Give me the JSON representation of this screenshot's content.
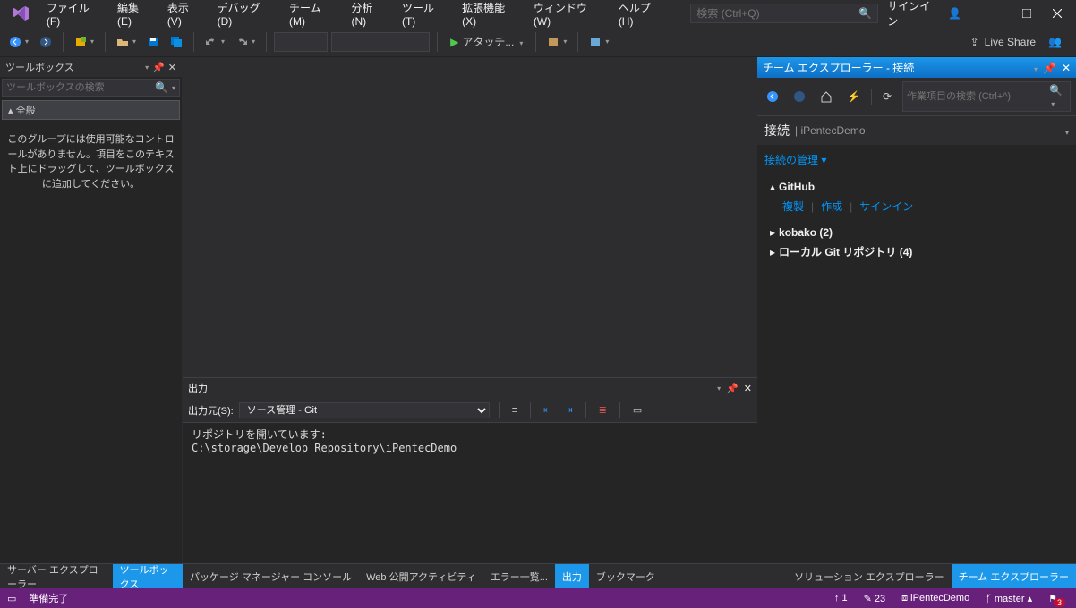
{
  "menu": [
    "ファイル(F)",
    "編集(E)",
    "表示(V)",
    "デバッグ(D)",
    "チーム(M)",
    "分析(N)",
    "ツール(T)",
    "拡張機能(X)",
    "ウィンドウ(W)",
    "ヘルプ(H)"
  ],
  "search_placeholder": "検索 (Ctrl+Q)",
  "signin": "サインイン",
  "toolbar": {
    "attach": "アタッチ..."
  },
  "liveshare": "Live Share",
  "toolbox": {
    "title": "ツールボックス",
    "search_placeholder": "ツールボックスの検索",
    "section": "全般",
    "empty": "このグループには使用可能なコントロールがありません。項目をこのテキスト上にドラッグして、ツールボックスに追加してください。"
  },
  "output": {
    "title": "出力",
    "from_label": "出力元(S):",
    "from_value": "ソース管理 - Git",
    "content": "リポジトリを開いています:\nC:\\storage\\Develop Repository\\iPentecDemo"
  },
  "team": {
    "header": "チーム エクスプローラー - 接続",
    "search_placeholder": "作業項目の検索 (Ctrl+^)",
    "connect": "接続",
    "project": "iPentecDemo",
    "manage": "接続の管理 ▾",
    "github": "GitHub",
    "gh_actions": [
      "複製",
      "作成",
      "サインイン"
    ],
    "nodes": [
      "kobako (2)",
      "ローカル Git リポジトリ (4)"
    ]
  },
  "bottom_tabs_left": [
    "サーバー エクスプローラー",
    "ツールボックス"
  ],
  "bottom_tabs_center": [
    "パッケージ マネージャー コンソール",
    "Web 公開アクティビティ",
    "エラー一覧...",
    "出力",
    "ブックマーク"
  ],
  "bottom_tabs_right": [
    "ソリューション エクスプローラー",
    "チーム エクスプローラー"
  ],
  "status": {
    "ready": "準備完了",
    "up": "1",
    "pencil": "23",
    "repo": "iPentecDemo",
    "branch": "master",
    "notif": "3"
  }
}
